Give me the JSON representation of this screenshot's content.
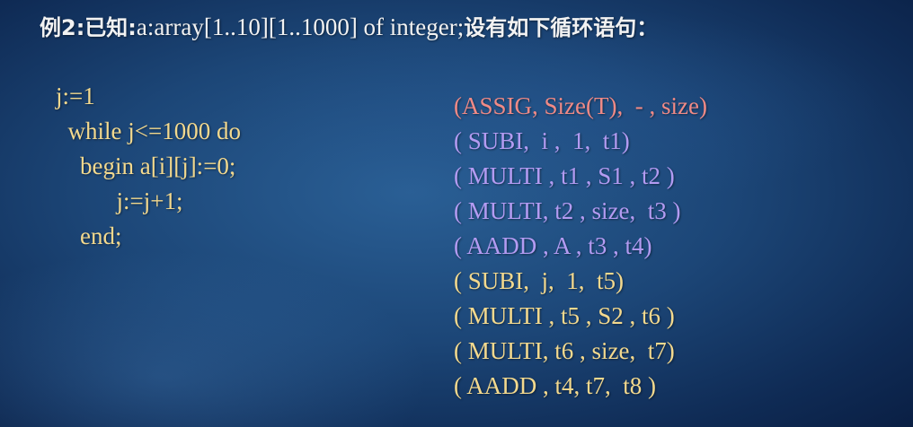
{
  "colors": {
    "title": "#f2f2f2",
    "code": "#f3d98e",
    "quad_red": "#f08a86",
    "quad_purple": "#b39bf2",
    "quad_yellow": "#f3d98e"
  },
  "title": {
    "lead": "例2:已知:",
    "decl": "a:array[1..10][1..1000] of integer;",
    "tail": "设有如下循环语句："
  },
  "code_lines": [
    "j:=1",
    "  while j<=1000 do",
    "    begin a[i][j]:=0;",
    "          j:=j+1;",
    "    end;"
  ],
  "quads": [
    {
      "text": "(ASSIG, Size(T),  - , size)",
      "color": "#f08a86"
    },
    {
      "text": "( SUBI,  i ,  1,  t1)",
      "color": "#b39bf2"
    },
    {
      "text": "( MULTI , t1 , S1 , t2 )",
      "color": "#b39bf2"
    },
    {
      "text": "( MULTI, t2 , size,  t3 )",
      "color": "#b39bf2"
    },
    {
      "text": "( AADD , A , t3 , t4)",
      "color": "#b39bf2"
    },
    {
      "text": "( SUBI,  j,  1,  t5)",
      "color": "#f3d98e"
    },
    {
      "text": "( MULTI , t5 , S2 , t6 )",
      "color": "#f3d98e"
    },
    {
      "text": "( MULTI, t6 , size,  t7)",
      "color": "#f3d98e"
    },
    {
      "text": "( AADD , t4, t7,  t8 )",
      "color": "#f3d98e"
    }
  ]
}
